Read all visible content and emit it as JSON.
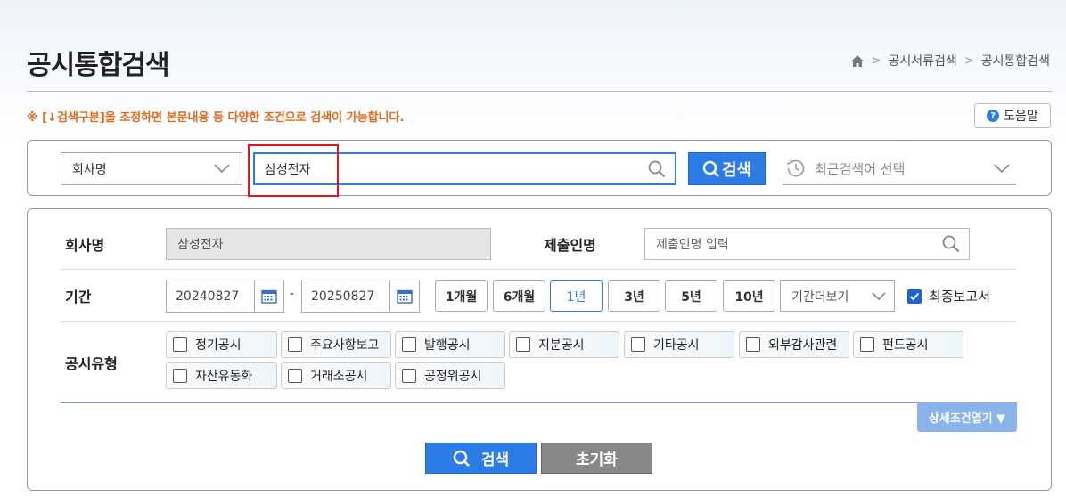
{
  "page": {
    "title": "공시통합검색"
  },
  "breadcrumb": {
    "items": [
      "공시서류검색",
      "공시통합검색"
    ],
    "home_icon": "home-icon"
  },
  "notice": "※ [↓검색구분]을 조정하면 본문내용 등 다양한 조건으로 검색이 가능합니다.",
  "help": {
    "label": "도움말",
    "icon": "question-icon"
  },
  "search": {
    "type_select": "회사명",
    "query_value": "삼성전자",
    "button_label": "검색",
    "recent_placeholder": "최근검색어 선택"
  },
  "form": {
    "company": {
      "label": "회사명",
      "value": "삼성전자"
    },
    "submitter": {
      "label": "제출인명",
      "placeholder": "제출인명 입력"
    },
    "period": {
      "label": "기간",
      "start": "20240827",
      "end": "20250827",
      "separator": "-",
      "buttons": [
        "1개월",
        "6개월",
        "1년",
        "3년",
        "5년",
        "10년"
      ],
      "active_button": "1년",
      "more_select": "기간더보기",
      "final_report_label": "최종보고서",
      "final_report_checked": true
    },
    "disclosure_type": {
      "label": "공시유형",
      "row1": [
        "정기공시",
        "주요사항보고",
        "발행공시",
        "지분공시",
        "기타공시",
        "외부감사관련",
        "펀드공시"
      ],
      "row2": [
        "자산유동화",
        "거래소공시",
        "공정위공시"
      ]
    },
    "detail_toggle_label": "상세조건열기 ▼",
    "search_button": "검색",
    "reset_button": "초기화"
  },
  "colors": {
    "accent": "#2d7be5",
    "notice": "#e56a17",
    "highlight": "#e0181b"
  }
}
